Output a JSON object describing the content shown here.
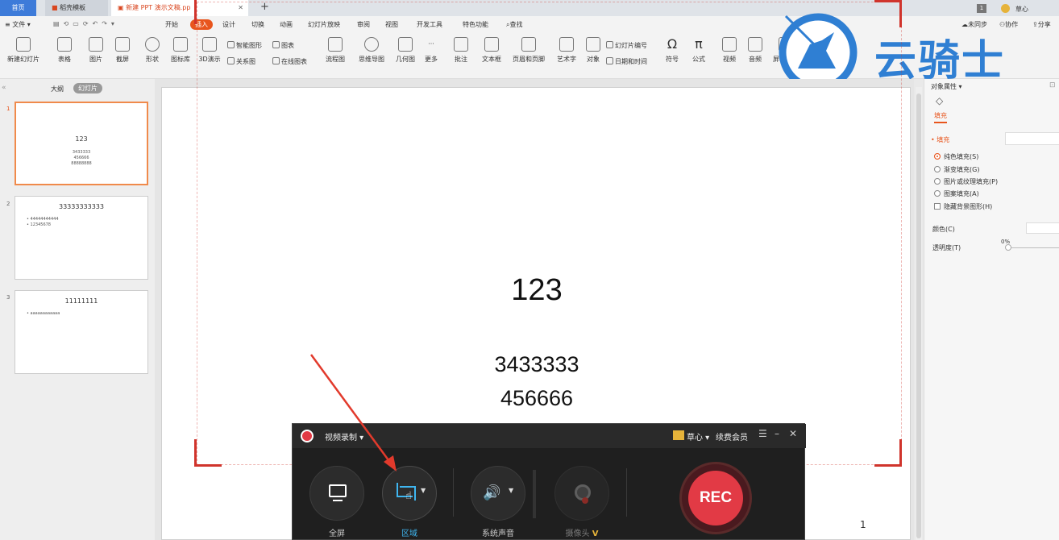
{
  "tabs": {
    "home": "首页",
    "template": "稻壳模板",
    "doc": "新建 PPT 演示文稿.pp",
    "add": "+"
  },
  "menu": {
    "file": "文件",
    "items": [
      "开始",
      "插入",
      "设计",
      "切换",
      "动画",
      "幻灯片放映",
      "审阅",
      "视图",
      "开发工具",
      "特色功能",
      "查找"
    ],
    "right": [
      "未同步",
      "协作",
      "分享"
    ]
  },
  "ribbon": {
    "big": [
      "新建幻灯片",
      "表格",
      "图片",
      "截屏",
      "形状",
      "图标库",
      "3D演示",
      "流程图",
      "思维导图",
      "几何图",
      "更多",
      "批注",
      "文本框",
      "页眉和页脚",
      "艺术字",
      "对象",
      "符号",
      "公式",
      "视频",
      "音频",
      "屏幕录制"
    ],
    "small": [
      "智能图形",
      "图表",
      "关系图",
      "在线图表",
      "幻灯片编号",
      "日期和时间"
    ]
  },
  "user": {
    "badge": "1",
    "name": "草心"
  },
  "watermark": {
    "text": "云骑士"
  },
  "leftpane": {
    "tab_outline": "大纲",
    "tab_slides": "幻灯片",
    "slides": [
      {
        "num": "1",
        "title": "123",
        "lines": [
          "3433333",
          "456666",
          "88888888"
        ]
      },
      {
        "num": "2",
        "title": "33333333333",
        "lines": [
          "• 44444444444",
          "• 12345678"
        ]
      },
      {
        "num": "3",
        "title": "11111111",
        "lines": [
          "• aaaaaaaaaaaa"
        ]
      }
    ]
  },
  "slide": {
    "title": "123",
    "line1": "3433333",
    "line2": "456666",
    "page": "1"
  },
  "rightpane": {
    "header": "对象属性",
    "tab": "填充",
    "section": "填充",
    "options": [
      "纯色填充(S)",
      "渐变填充(G)",
      "图片或纹理填充(P)",
      "图案填充(A)"
    ],
    "checkbox": "隐藏背景图形(H)",
    "color_label": "颜色(C)",
    "transparency_label": "透明度(T)",
    "transparency_value": "0%"
  },
  "recorder": {
    "title": "视频录制",
    "user": "草心",
    "vip": "续费会员",
    "tools": [
      {
        "label": "全屏"
      },
      {
        "label": "区域"
      },
      {
        "label": "系统声音"
      },
      {
        "label": "摄像头"
      }
    ],
    "rec": "REC"
  },
  "colors": {
    "accent": "#e8551d",
    "rec": "#e23a45",
    "marker": "#d0342c",
    "watermark": "#2f7fd3"
  }
}
